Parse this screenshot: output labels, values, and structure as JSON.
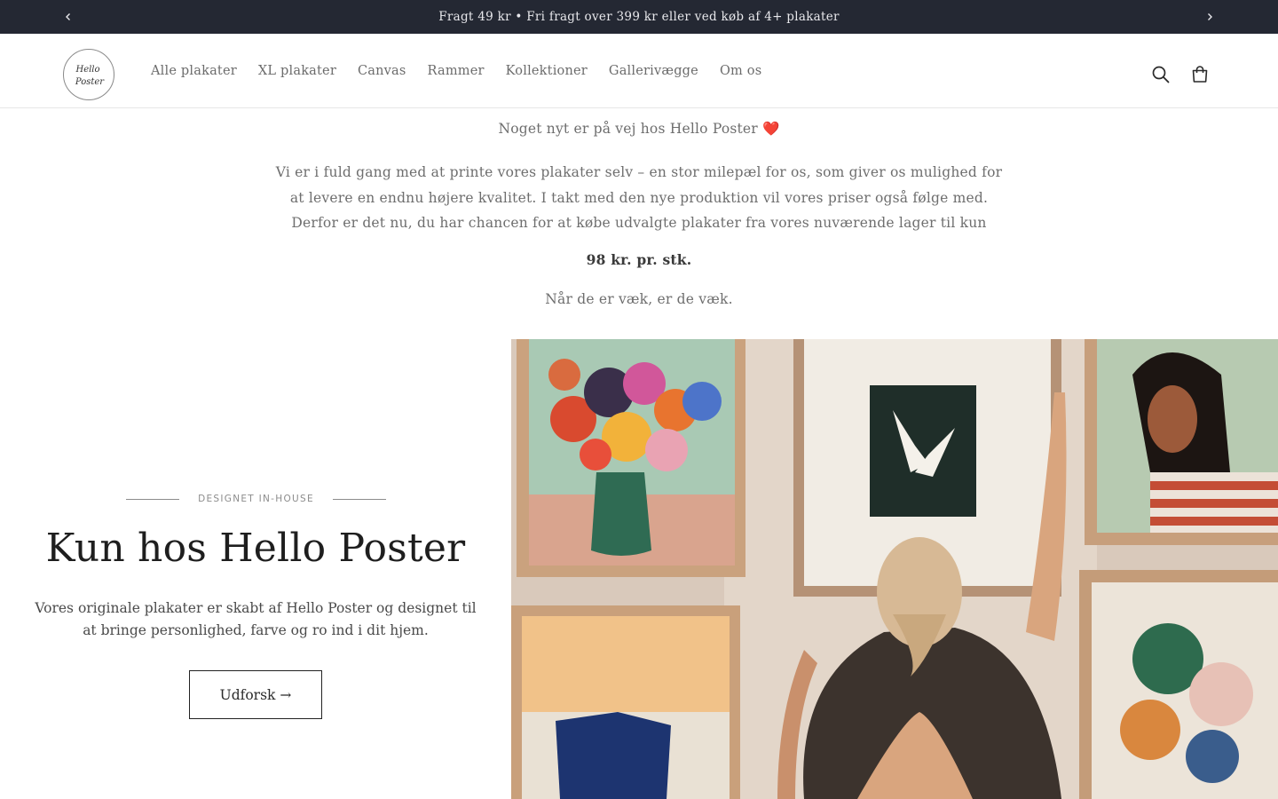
{
  "announcement": {
    "text": "Fragt 49 kr • Fri fragt over 399 kr eller ved køb af 4+ plakater",
    "prev_icon": "chevron-left-icon",
    "next_icon": "chevron-right-icon"
  },
  "header": {
    "logo_line1": "Hello",
    "logo_line2": "Poster",
    "nav": [
      "Alle plakater",
      "XL plakater",
      "Canvas",
      "Rammer",
      "Kollektioner",
      "Gallerivægge",
      "Om os"
    ],
    "icons": [
      "search-icon",
      "cart-icon"
    ]
  },
  "notice": {
    "title": "Noget nyt er på vej hos Hello Poster ❤️",
    "body_lines": [
      "Vi er i fuld gang med at printe vores plakater selv – en stor milepæl for os, som giver os mulighed for",
      "at levere en endnu højere kvalitet. I takt med den nye produktion vil vores priser også følge med.",
      "Derfor er det nu, du har chancen for at købe udvalgte plakater fra vores nuværende lager til kun"
    ],
    "price": "98 kr. pr. stk.",
    "outro": "Når de er væk, er de væk."
  },
  "hero": {
    "eyebrow": "DESIGNET IN-HOUSE",
    "title": "Kun hos Hello Poster",
    "text": "Vores originale plakater er skabt af Hello Poster og designet til at bringe personlighed, farve og ro ind i dit hjem.",
    "button_label": "Udforsk →"
  },
  "colors": {
    "announcement_bg": "#242833",
    "text": "#3c3c3c"
  }
}
